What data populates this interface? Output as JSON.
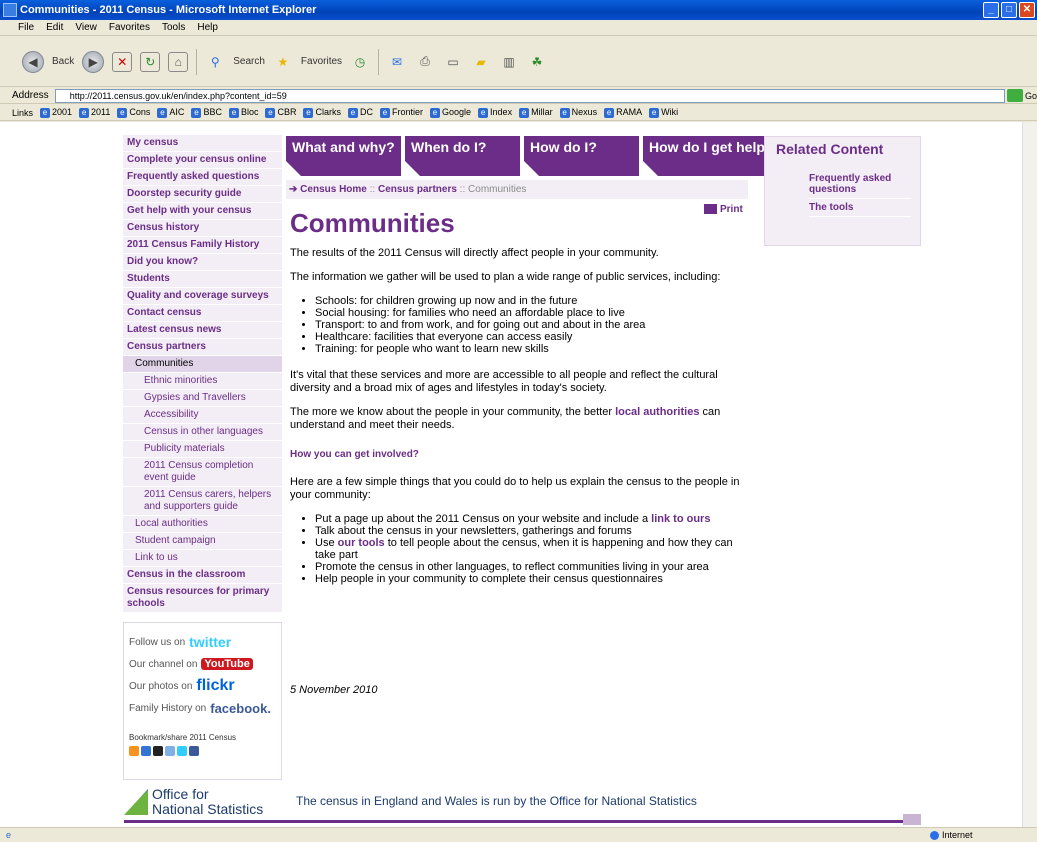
{
  "window": {
    "title": "Communities - 2011 Census - Microsoft Internet Explorer",
    "controls": [
      "_",
      "□",
      "✕"
    ]
  },
  "menu": [
    "File",
    "Edit",
    "View",
    "Favorites",
    "Tools",
    "Help"
  ],
  "toolbar": {
    "back": "Back",
    "search": "Search",
    "favorites": "Favorites"
  },
  "address": {
    "label": "Address",
    "url": "http://2011.census.gov.uk/en/index.php?content_id=59",
    "go": "Go"
  },
  "links": {
    "label": "Links",
    "items": [
      "2001",
      "2011",
      "Cons",
      "AIC",
      "BBC",
      "Bloc",
      "CBR",
      "Clarks",
      "DC",
      "Frontier",
      "Google",
      "Index",
      "Millar",
      "Nexus",
      "RAMA",
      "Wiki"
    ]
  },
  "nav": [
    {
      "label": "My census",
      "level": 0
    },
    {
      "label": "Complete your census online",
      "level": 0
    },
    {
      "label": "Frequently asked questions",
      "level": 0
    },
    {
      "label": "Doorstep security guide",
      "level": 0
    },
    {
      "label": "Get help with your census",
      "level": 0
    },
    {
      "label": "Census history",
      "level": 0
    },
    {
      "label": "2011 Census Family History",
      "level": 0
    },
    {
      "label": "Did you know?",
      "level": 0
    },
    {
      "label": "Students",
      "level": 0
    },
    {
      "label": "Quality and coverage surveys",
      "level": 0
    },
    {
      "label": "Contact census",
      "level": 0
    },
    {
      "label": "Latest census news",
      "level": 0
    },
    {
      "label": "Census partners",
      "level": 0
    },
    {
      "label": "Communities",
      "level": 1,
      "active": true
    },
    {
      "label": "Ethnic minorities",
      "level": 2
    },
    {
      "label": "Gypsies and Travellers",
      "level": 2
    },
    {
      "label": "Accessibility",
      "level": 2
    },
    {
      "label": "Census in other languages",
      "level": 2
    },
    {
      "label": "Publicity materials",
      "level": 2
    },
    {
      "label": "2011 Census completion event guide",
      "level": 2
    },
    {
      "label": "2011 Census carers, helpers and supporters guide",
      "level": 2
    },
    {
      "label": "Local authorities",
      "level": 1
    },
    {
      "label": "Student campaign",
      "level": 1
    },
    {
      "label": "Link to us",
      "level": 1
    },
    {
      "label": "Census in the classroom",
      "level": 0
    },
    {
      "label": "Census resources for primary schools",
      "level": 0
    }
  ],
  "social": {
    "rows": [
      {
        "prefix": "Follow us on",
        "brand": "twitter",
        "cls": "tw"
      },
      {
        "prefix": "Our channel on",
        "brand": "YouTube",
        "cls": "yt"
      },
      {
        "prefix": "Our photos on",
        "brand": "flickr",
        "cls": "fl"
      },
      {
        "prefix": "Family History on",
        "brand": "facebook.",
        "cls": "fb"
      }
    ],
    "bookmark": "Bookmark/share 2011 Census"
  },
  "tabs": [
    "What and why?",
    "When do I?",
    "How do I?",
    "How do I get help?"
  ],
  "breadcrumb": {
    "home": "Census Home",
    "partners": "Census partners",
    "current": "Communities"
  },
  "print": "Print",
  "related": {
    "title": "Related Content",
    "links": [
      "Frequently asked questions",
      "The tools"
    ]
  },
  "content": {
    "title": "Communities",
    "p1": "The results of the 2011 Census will directly affect people in your community.",
    "p2": "The information we gather will be used to plan a wide range of public services, including:",
    "services": [
      "Schools: for children growing up now and in the future",
      "Social housing: for families who need an affordable place to live",
      "Transport: to and from work, and for going out and about in the area",
      "Healthcare: facilities that everyone can access easily",
      "Training: for people who want to learn new skills"
    ],
    "p3": "It's vital that these services and more are accessible to all people and reflect the cultural diversity and a broad mix of ages and lifestyles in today's society.",
    "p4_a": "The more we know about the people in your community, the better ",
    "p4_link": "local authorities",
    "p4_b": " can understand and meet their needs.",
    "involved": "How you can get involved?",
    "p5": "Here are a few simple things that you could do to help us explain the census to the people in your community:",
    "a1_a": "Put a page up about the 2011 Census on your website and include a ",
    "a1_link": "link to ours",
    "a2": "Talk about the census in your newsletters, gatherings and forums",
    "a3_a": "Use ",
    "a3_link": "our tools",
    "a3_b": " to tell people about the census, when it is happening and how they can take part",
    "a4": "Promote the census in other languages, to reflect communities living in your area",
    "a5": "Help people in your community to complete their census questionnaires",
    "date": "5 November 2010"
  },
  "footer": {
    "ons_line1": "Office for",
    "ons_line2": "National Statistics",
    "text": "The census in England and Wales is run by the Office for National Statistics"
  },
  "status": {
    "zone": "Internet"
  },
  "colors": {
    "brand_purple": "#6b2d87",
    "nav_bg": "#f3eef5"
  }
}
